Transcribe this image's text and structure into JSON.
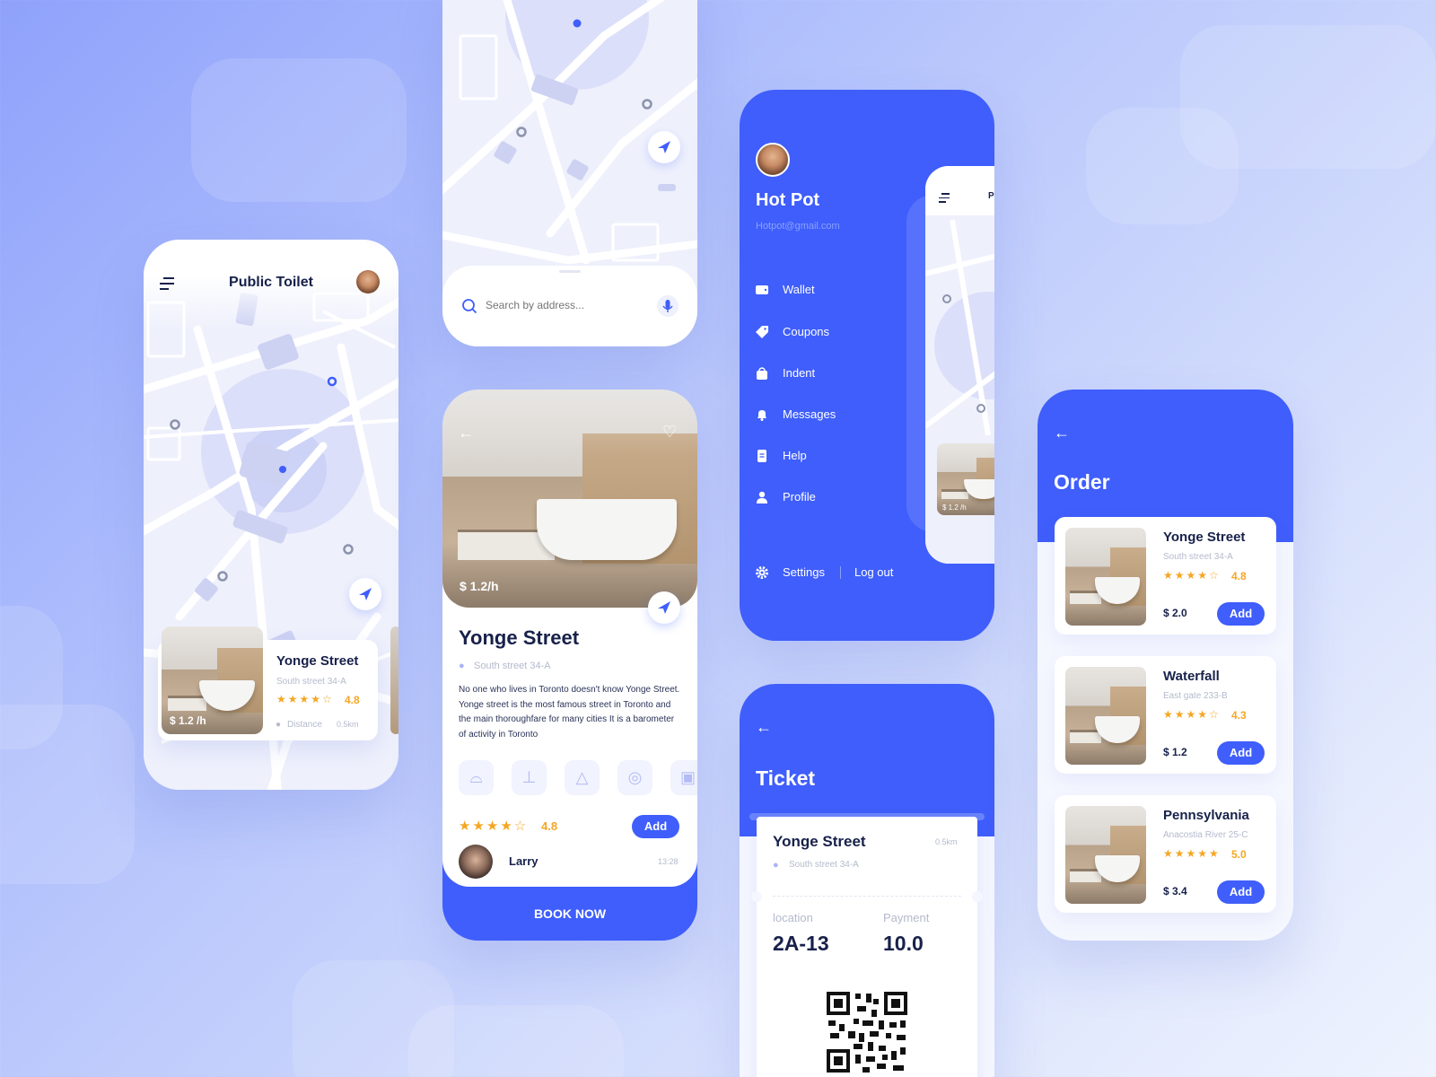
{
  "colors": {
    "accent": "#3f5efb",
    "navy": "#17214a",
    "star": "#f5a623",
    "muted": "#b4bacc"
  },
  "map_screen": {
    "title": "Public Toilet",
    "card": {
      "name": "Yonge Street",
      "address": "South street 34-A",
      "rating": "4.8",
      "distance_label": "Distance",
      "distance": "0.5km",
      "price": "$ 1.2 /h"
    }
  },
  "search_screen": {
    "placeholder": "Search by address..."
  },
  "detail_screen": {
    "price": "$ 1.2/h",
    "name": "Yonge Street",
    "address": "South street 34-A",
    "description": "No one who lives in Toronto doesn't know Yonge Street. Yonge street is the most famous street in Toronto and the main thoroughfare for many cities It is a barometer of activity in Toronto",
    "amenities": [
      "toilet-icon",
      "sink-icon",
      "urinal-icon",
      "tissue-roll-icon",
      "hand-dryer-icon"
    ],
    "rating": "4.8",
    "add_label": "Add",
    "reviewer": {
      "name": "Larry",
      "time": "13:28"
    },
    "book_label": "BOOK NOW"
  },
  "drawer_screen": {
    "user_name": "Hot Pot",
    "email": "Hotpot@gmail.com",
    "items": [
      {
        "label": "Wallet",
        "icon": "wallet-icon"
      },
      {
        "label": "Coupons",
        "icon": "tag-icon"
      },
      {
        "label": "Indent",
        "icon": "bag-icon"
      },
      {
        "label": "Messages",
        "icon": "bell-icon"
      },
      {
        "label": "Help",
        "icon": "document-icon"
      },
      {
        "label": "Profile",
        "icon": "user-icon"
      }
    ],
    "settings_label": "Settings",
    "logout_label": "Log out",
    "peek_price": "$ 1.2 /h",
    "peek_title": "P"
  },
  "ticket_screen": {
    "title": "Ticket",
    "name": "Yonge Street",
    "distance": "0.5km",
    "address": "South street 34-A",
    "location_label": "location",
    "location_value": "2A-13",
    "payment_label": "Payment",
    "payment_value": "10.0"
  },
  "order_screen": {
    "title": "Order",
    "items": [
      {
        "name": "Yonge Street",
        "address": "South street 34-A",
        "rating": "4.8",
        "price": "$ 2.0",
        "add": "Add"
      },
      {
        "name": "Waterfall",
        "address": "East gate 233-B",
        "rating": "4.3",
        "price": "$ 1.2",
        "add": "Add"
      },
      {
        "name": "Pennsylvania",
        "address": "Anacostia River 25-C",
        "rating": "5.0",
        "price": "$ 3.4",
        "add": "Add"
      }
    ]
  }
}
